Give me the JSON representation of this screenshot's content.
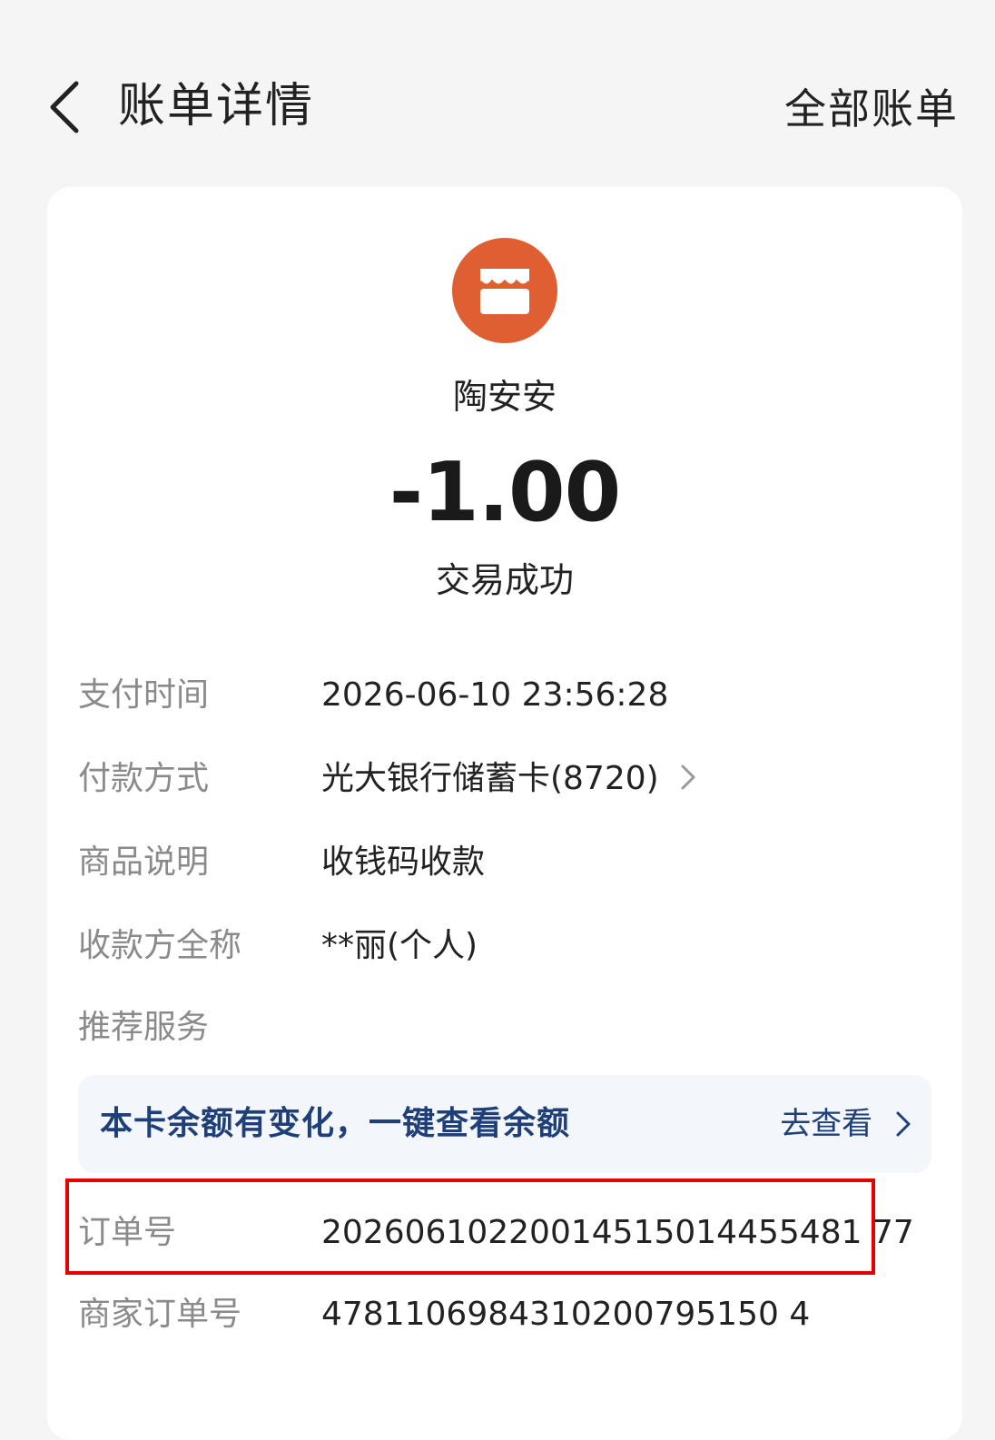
{
  "header": {
    "title": "账单详情",
    "all_bills_label": "全部账单"
  },
  "merchant": {
    "icon": "store-icon",
    "name": "陶安安",
    "logo_color": "#df5f33"
  },
  "transaction": {
    "amount": "-1.00",
    "status": "交易成功"
  },
  "details": {
    "pay_time": {
      "label": "支付时间",
      "value": "2026-06-10 23:56:28"
    },
    "payment_method": {
      "label": "付款方式",
      "value": "光大银行储蓄卡(8720)"
    },
    "goods_desc": {
      "label": "商品说明",
      "value": "收钱码收款"
    },
    "payee": {
      "label": "收款方全称",
      "value": "**丽(个人)"
    },
    "recommend": {
      "label": "推荐服务"
    },
    "order_no": {
      "label": "订单号",
      "value": "20260610220014515014455481 77"
    },
    "merchant_order_no": {
      "label": "商家订单号",
      "value": "4781106984310200795150 4"
    }
  },
  "promo": {
    "text": "本卡余额有变化，一键查看余额",
    "link_label": "去查看",
    "color": "#1f3f78"
  },
  "highlight": {
    "color": "#e60000",
    "target": "order-number-row"
  }
}
